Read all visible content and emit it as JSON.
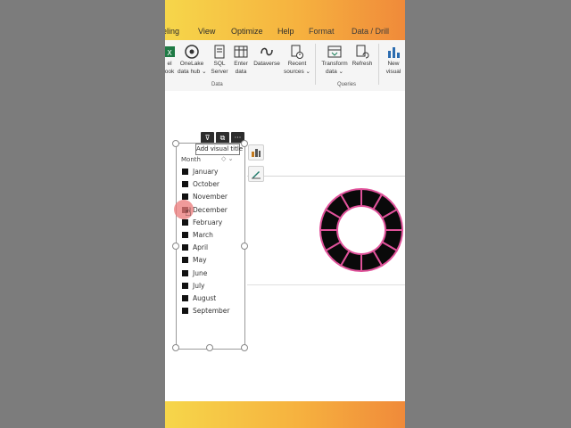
{
  "tabs": [
    {
      "label": "eling",
      "active": false
    },
    {
      "label": "View",
      "active": false
    },
    {
      "label": "Optimize",
      "active": false
    },
    {
      "label": "Help",
      "active": false
    },
    {
      "label": "Format",
      "active": true
    },
    {
      "label": "Data / Drill",
      "active": true
    }
  ],
  "ribbon": {
    "buttons": [
      {
        "line1": "el",
        "line2": "ook"
      },
      {
        "line1": "OneLake",
        "line2": "data hub ⌄"
      },
      {
        "line1": "SQL",
        "line2": "Server"
      },
      {
        "line1": "Enter",
        "line2": "data"
      },
      {
        "line1": "Dataverse",
        "line2": ""
      },
      {
        "line1": "Recent",
        "line2": "sources ⌄"
      },
      {
        "line1": "Transform",
        "line2": "data ⌄"
      },
      {
        "line1": "Refresh",
        "line2": ""
      },
      {
        "line1": "New",
        "line2": "visual"
      }
    ],
    "groups": {
      "data": "Data",
      "queries": "Queries"
    }
  },
  "slicer": {
    "tooltip": "Add visual title",
    "header": "Month",
    "header_icons": "◇ ⌄",
    "toolbar": {
      "filter": "⊽",
      "focus": "⧉",
      "more": "···"
    },
    "items": [
      "January",
      "October",
      "November",
      "December",
      "February",
      "March",
      "April",
      "May",
      "June",
      "July",
      "August",
      "September"
    ]
  },
  "colors": {
    "ring": "#0a0a0a",
    "ring_separator": "#e0529a",
    "banner_start": "#f6d64a",
    "banner_end": "#f08a3a"
  },
  "donut": {
    "segments": 12
  }
}
